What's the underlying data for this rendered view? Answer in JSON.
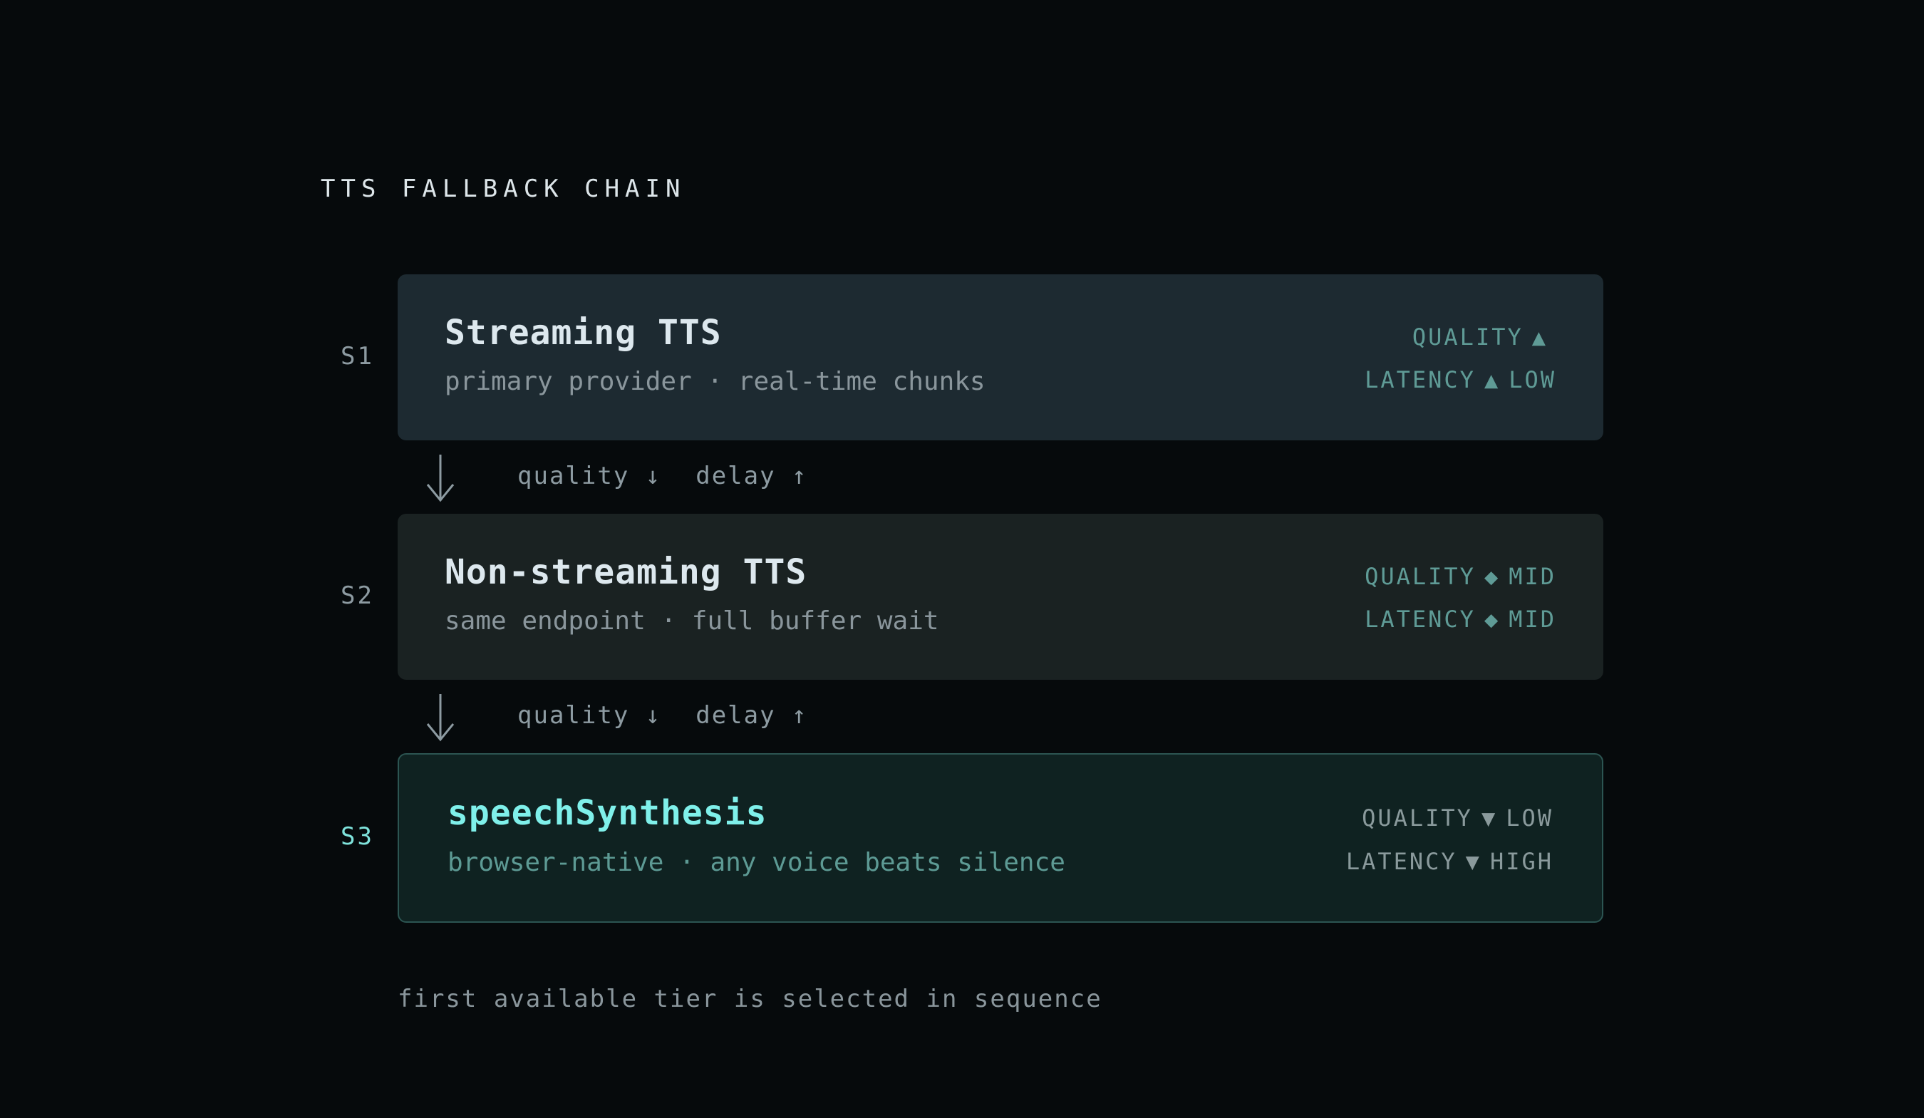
{
  "title": "TTS FALLBACK CHAIN",
  "steps": [
    {
      "id": "S1",
      "name": "Streaming TTS",
      "subtitle": "primary provider · real-time chunks",
      "quality_label": "QUALITY",
      "quality_symbol": "▲",
      "quality_value": "",
      "latency_label": "LATENCY",
      "latency_symbol": "▲",
      "latency_value": "LOW"
    },
    {
      "id": "S2",
      "name": "Non-streaming TTS",
      "subtitle": "same endpoint · full buffer wait",
      "quality_label": "QUALITY",
      "quality_symbol": "◆",
      "quality_value": "MID",
      "latency_label": "LATENCY",
      "latency_symbol": "◆",
      "latency_value": "MID"
    },
    {
      "id": "S3",
      "name": "speechSynthesis",
      "subtitle": "browser-native · any voice beats silence",
      "quality_label": "QUALITY",
      "quality_symbol": "▼",
      "quality_value": "LOW",
      "latency_label": "LATENCY",
      "latency_symbol": "▼",
      "latency_value": "HIGH"
    }
  ],
  "transitions": [
    {
      "quality": "quality ↓",
      "delay": "delay ↑"
    },
    {
      "quality": "quality ↓",
      "delay": "delay ↑"
    }
  ],
  "footer": "first available tier is selected in sequence",
  "colors": {
    "background": "#060a0c",
    "accent": "#7ff0ea",
    "metric": "#5f9b96"
  }
}
